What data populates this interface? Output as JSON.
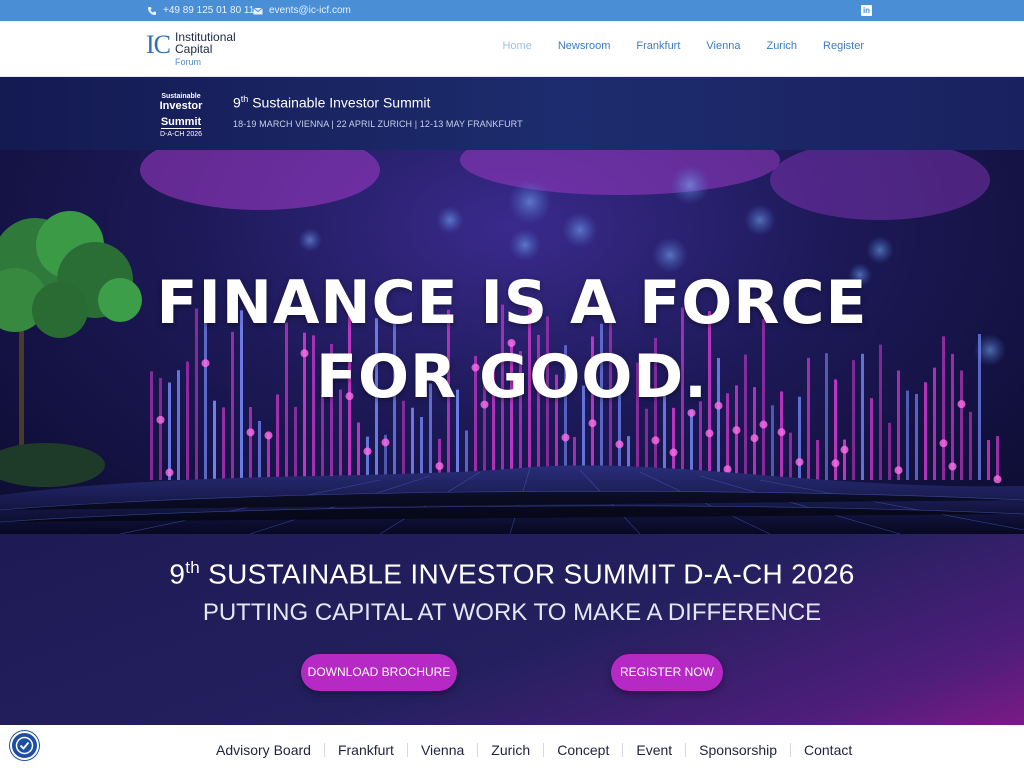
{
  "topbar": {
    "phone": "+49 89 125 01 80 11",
    "email": "events@ic-icf.com",
    "icons": [
      "phone-icon",
      "envelope-icon",
      "linkedin-icon"
    ]
  },
  "logo": {
    "mark": "IC",
    "line1": "Institutional",
    "line2": "Capital",
    "line3": "Forum"
  },
  "nav": {
    "items": [
      "Home",
      "Newsroom",
      "Frankfurt",
      "Vienna",
      "Zurich",
      "Register"
    ],
    "active": "Home"
  },
  "summit_banner": {
    "badge": {
      "line1": "Sustainable",
      "line2": "Investor",
      "line3": "Summit",
      "line4": "D-A-CH 2026"
    },
    "title_num": "9",
    "title_sup": "th",
    "title_rest": " Sustainable Investor Summit",
    "dates": "18-19 MARCH VIENNA | 22 APRIL ZURICH | 12-13 MAY FRANKFURT"
  },
  "hero": {
    "line1": "FINANCE IS A FORCE",
    "line2": "FOR GOOD."
  },
  "section": {
    "title_num": "9",
    "title_sup": "th",
    "title_rest": " SUSTAINABLE INVESTOR SUMMIT D-A-CH 2026",
    "subtitle": "PUTTING CAPITAL AT WORK TO MAKE A DIFFERENCE",
    "brochure_button": "DOWNLOAD BROCHURE",
    "register_button": "REGISTER NOW"
  },
  "subnav": {
    "items": [
      "Advisory Board",
      "Frankfurt",
      "Vienna",
      "Zurich",
      "Concept",
      "Event",
      "Sponsorship",
      "Contact"
    ]
  },
  "colors": {
    "topbar": "#4a8fd6",
    "link": "#3a7cc4",
    "banner": "#1d2c6e",
    "button": "#b629c4"
  }
}
